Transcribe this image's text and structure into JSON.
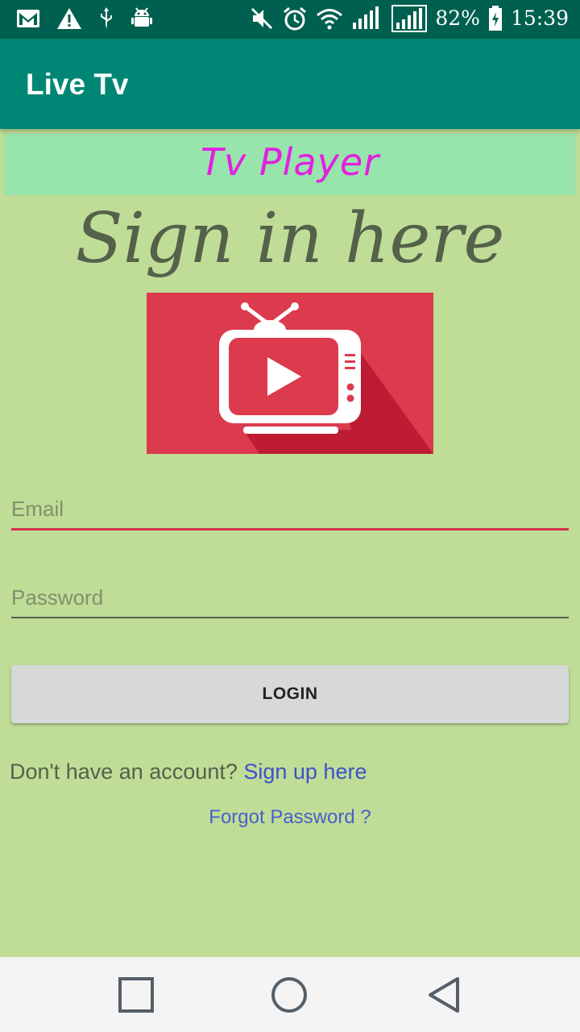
{
  "status_bar": {
    "icons_left": [
      "gmail-icon",
      "warning-icon",
      "usb-icon",
      "android-debug-icon"
    ],
    "icons_right": [
      "mute-icon",
      "alarm-icon",
      "wifi-icon",
      "signal-icon",
      "signal-2-icon",
      "battery-icon"
    ],
    "battery": "82%",
    "time": "15:39"
  },
  "app_bar": {
    "title": "Live Tv"
  },
  "banner": {
    "text": "Tv Player"
  },
  "main": {
    "heading": "Sign in here",
    "logo": "tv-play-logo"
  },
  "form": {
    "email_placeholder": "Email",
    "password_placeholder": "Password",
    "login_label": "LOGIN",
    "signup_prompt": "Don't have an account? ",
    "signup_link": "Sign up here",
    "forgot_link": "Forgot Password ?"
  },
  "colors": {
    "status_bar": "#00604f",
    "app_bar": "#008675",
    "background": "#bfdd97",
    "banner": "#97e4ac",
    "banner_text": "#e41fe0",
    "logo_bg": "#dc3a4d",
    "link": "#3e51c8",
    "email_underline": "#d2334a"
  },
  "nav_bar": {
    "items": [
      "recents-square-icon",
      "home-circle-icon",
      "back-triangle-icon"
    ]
  }
}
